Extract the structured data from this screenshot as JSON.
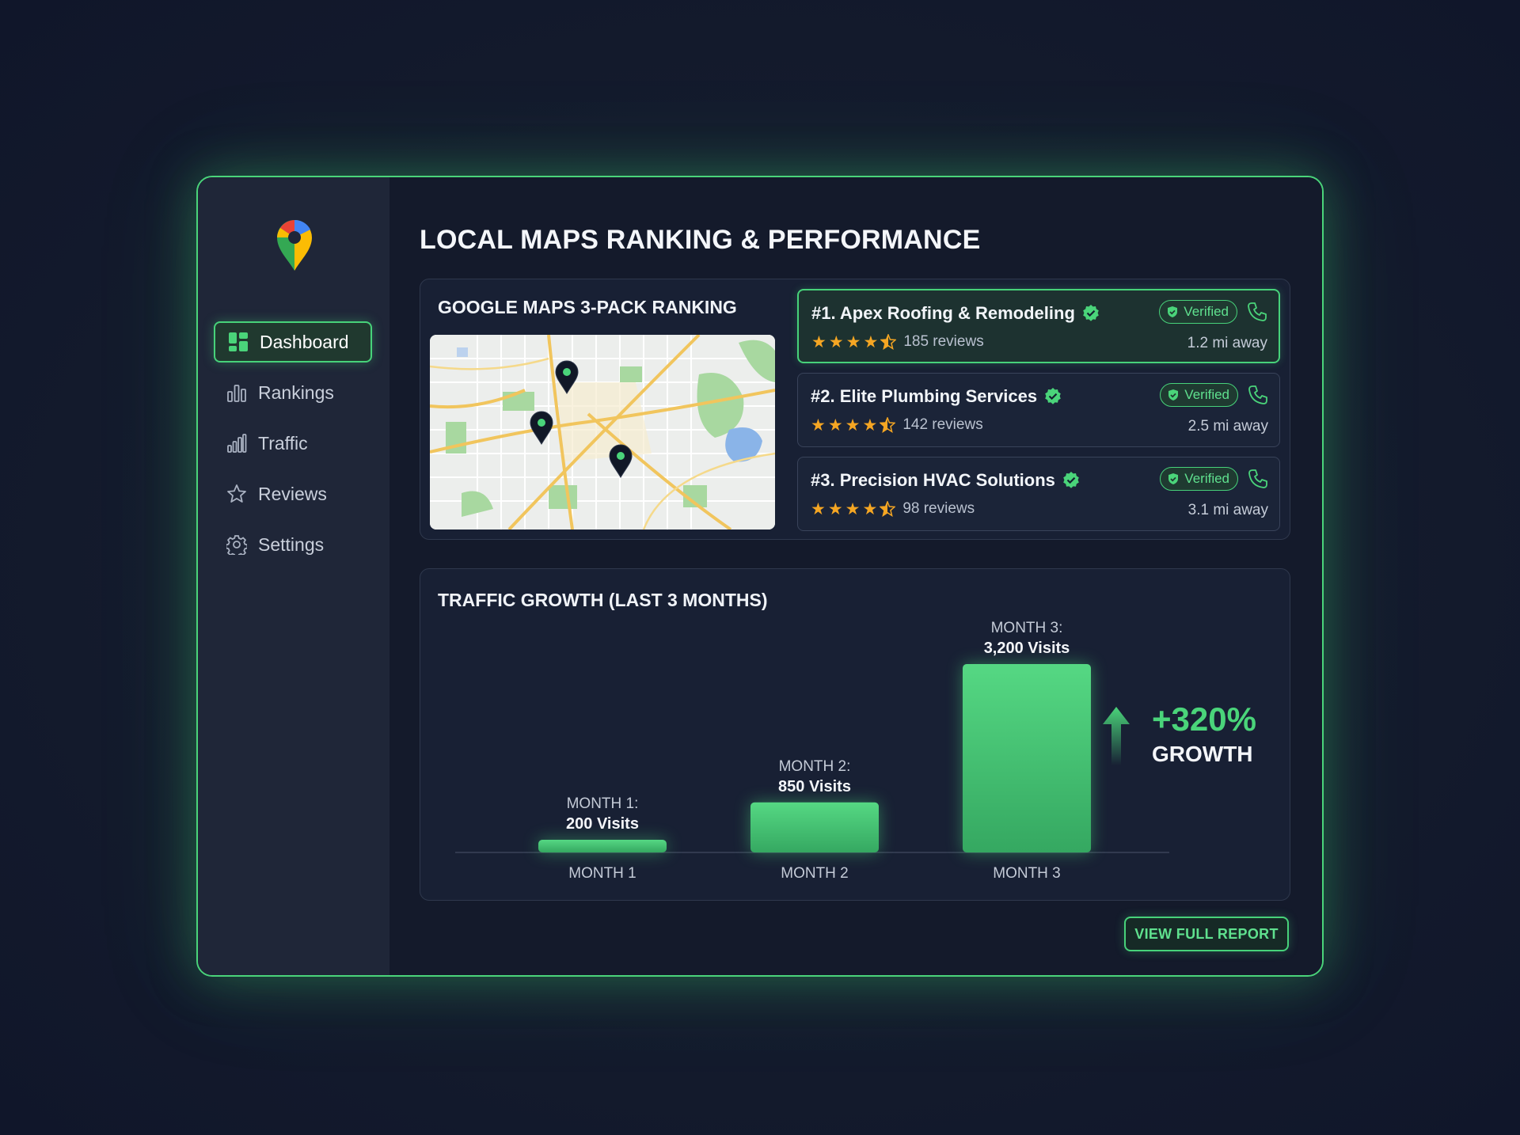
{
  "app": {
    "title": "LOCAL MAPS RANKING & PERFORMANCE",
    "logo_icon": "google-maps-pin-icon"
  },
  "sidebar": {
    "items": [
      {
        "label": "Dashboard",
        "icon": "dashboard-icon",
        "active": true
      },
      {
        "label": "Rankings",
        "icon": "bar-chart-icon",
        "active": false
      },
      {
        "label": "Traffic",
        "icon": "signal-bars-icon",
        "active": false
      },
      {
        "label": "Reviews",
        "icon": "star-icon",
        "active": false
      },
      {
        "label": "Settings",
        "icon": "gear-icon",
        "active": false
      }
    ]
  },
  "ranking": {
    "title": "GOOGLE MAPS 3-PACK RANKING",
    "listings": [
      {
        "name": "#1. Apex Roofing & Remodeling",
        "rating": 4.5,
        "reviews": "185 reviews",
        "badge": "Verified",
        "distance": "1.2 mi away"
      },
      {
        "name": "#2. Elite Plumbing Services",
        "rating": 4.5,
        "reviews": "142 reviews",
        "badge": "Verified",
        "distance": "2.5 mi away"
      },
      {
        "name": "#3. Precision HVAC Solutions",
        "rating": 4.5,
        "reviews": "98 reviews",
        "badge": "Verified",
        "distance": "3.1 mi away"
      }
    ]
  },
  "traffic": {
    "title": "TRAFFIC GROWTH (LAST 3 MONTHS)",
    "growth_pct": "+320%",
    "growth_label": "GROWTH"
  },
  "chart_data": {
    "type": "bar",
    "categories": [
      "MONTH 1",
      "MONTH 2",
      "MONTH 3"
    ],
    "values": [
      200,
      850,
      3200
    ],
    "value_labels": [
      {
        "top": "MONTH 1:",
        "bottom": "200 Visits"
      },
      {
        "top": "MONTH 2:",
        "bottom": "850 Visits"
      },
      {
        "top": "MONTH 3:",
        "bottom": "3,200 Visits"
      }
    ],
    "title": "TRAFFIC GROWTH (LAST 3 MONTHS)",
    "ylim": [
      0,
      3200
    ],
    "grid": false,
    "bar_color": "#4ad47a"
  },
  "footer": {
    "report_button": "VIEW FULL REPORT"
  },
  "colors": {
    "accent": "#4ad47a",
    "star": "#f5a623",
    "background": "#141a2b"
  }
}
